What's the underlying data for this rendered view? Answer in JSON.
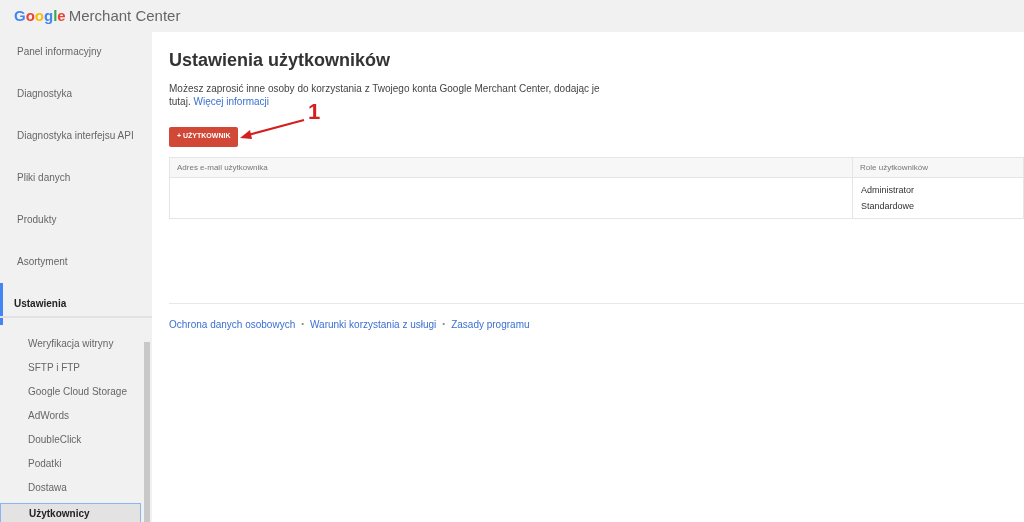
{
  "header": {
    "logo_google": "Google",
    "logo_product": "Merchant Center"
  },
  "sidebar": {
    "items": [
      {
        "label": "Panel informacyjny",
        "selected": false
      },
      {
        "label": "Diagnostyka",
        "selected": false
      },
      {
        "label": "Diagnostyka interfejsu API",
        "selected": false
      },
      {
        "label": "Pliki danych",
        "selected": false
      },
      {
        "label": "Produkty",
        "selected": false
      },
      {
        "label": "Asortyment",
        "selected": false
      },
      {
        "label": "Ustawienia",
        "selected": true,
        "children": [
          {
            "label": "Weryfikacja witryny",
            "selected": false
          },
          {
            "label": "SFTP i FTP",
            "selected": false
          },
          {
            "label": "Google Cloud Storage",
            "selected": false
          },
          {
            "label": "AdWords",
            "selected": false
          },
          {
            "label": "DoubleClick",
            "selected": false
          },
          {
            "label": "Podatki",
            "selected": false
          },
          {
            "label": "Dostawa",
            "selected": false
          },
          {
            "label": "Użytkownicy",
            "selected": true
          }
        ]
      }
    ]
  },
  "page": {
    "title": "Ustawienia użytkowników",
    "description": "Możesz zaprosić inne osoby do korzystania z Twojego konta Google Merchant Center, dodając je tutaj.",
    "more_link": "Więcej informacji",
    "add_button": "+ UŻYTKOWNIK",
    "annotation": "1",
    "table": {
      "columns": [
        "Adres e-mail użytkownika",
        "Role użytkowników"
      ],
      "rows": [
        {
          "email": "",
          "roles": [
            "Administrator",
            "Standardowe"
          ]
        }
      ]
    },
    "footer_links": [
      "Ochrona danych osobowych",
      "Warunki korzystania z usługi",
      "Zasady programu"
    ],
    "footer_separator": "•"
  }
}
